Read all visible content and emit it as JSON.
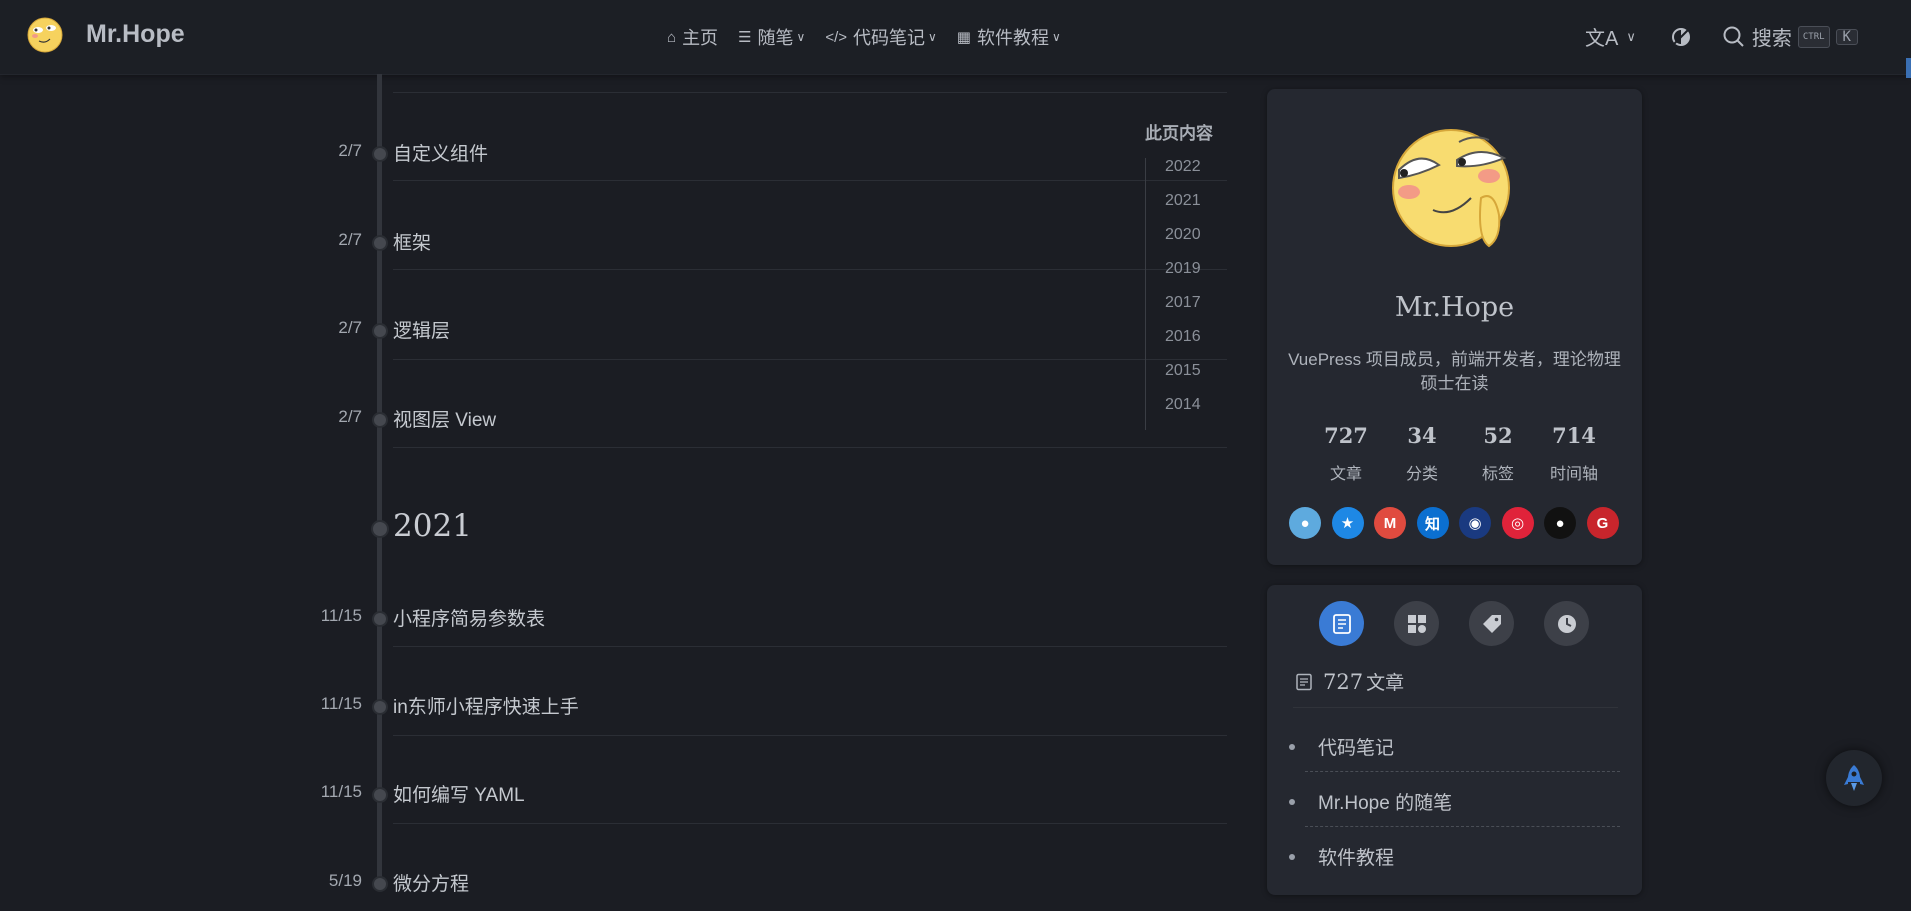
{
  "navbar": {
    "brand": "Mr.Hope",
    "links": [
      {
        "label": "主页",
        "icon": "home-icon"
      },
      {
        "label": "随笔",
        "icon": "notes-icon"
      },
      {
        "label": "代码笔记",
        "icon": "code-icon"
      },
      {
        "label": "软件教程",
        "icon": "apps-icon"
      }
    ],
    "search_label": "搜索",
    "kbd_ctrl": "CTRL",
    "kbd_k": "K"
  },
  "timeline": {
    "items_2022": [
      {
        "date": "2/7",
        "title": "自定义组件"
      },
      {
        "date": "2/7",
        "title": "框架"
      },
      {
        "date": "2/7",
        "title": "逻辑层"
      },
      {
        "date": "2/7",
        "title": "视图层 View"
      }
    ],
    "year_2021": "2021",
    "items_2021": [
      {
        "date": "11/15",
        "title": "小程序简易参数表"
      },
      {
        "date": "11/15",
        "title": "in东师小程序快速上手"
      },
      {
        "date": "11/15",
        "title": "如何编写 YAML"
      },
      {
        "date": "5/19",
        "title": "微分方程"
      }
    ]
  },
  "toc": {
    "heading": "此页内容",
    "years": [
      "2022",
      "2021",
      "2020",
      "2019",
      "2017",
      "2016",
      "2015",
      "2014"
    ]
  },
  "profile": {
    "name": "Mr.Hope",
    "description": "VuePress 项目成员，前端开发者，理论物理硕士在读",
    "stats": [
      {
        "num": "727",
        "label": "文章"
      },
      {
        "num": "34",
        "label": "分类"
      },
      {
        "num": "52",
        "label": "标签"
      },
      {
        "num": "714",
        "label": "时间轴"
      }
    ],
    "socials": [
      {
        "name": "qq-icon",
        "color": "#5eaade",
        "glyph": "●"
      },
      {
        "name": "qzone-icon",
        "color": "#1e88e5",
        "glyph": "★"
      },
      {
        "name": "gmail-icon",
        "color": "#e04b3f",
        "glyph": "M"
      },
      {
        "name": "zhihu-icon",
        "color": "#0b6fd0",
        "glyph": "知"
      },
      {
        "name": "steam-icon",
        "color": "#1a3a80",
        "glyph": "◉"
      },
      {
        "name": "weibo-icon",
        "color": "#e0233a",
        "glyph": "◎"
      },
      {
        "name": "github-icon",
        "color": "#111111",
        "glyph": "●"
      },
      {
        "name": "gitee-icon",
        "color": "#c8252c",
        "glyph": "G"
      }
    ]
  },
  "blog_info": {
    "article_count": "727",
    "article_label": "文章",
    "categories": [
      "代码笔记",
      "Mr.Hope 的随笔",
      "软件教程"
    ]
  }
}
